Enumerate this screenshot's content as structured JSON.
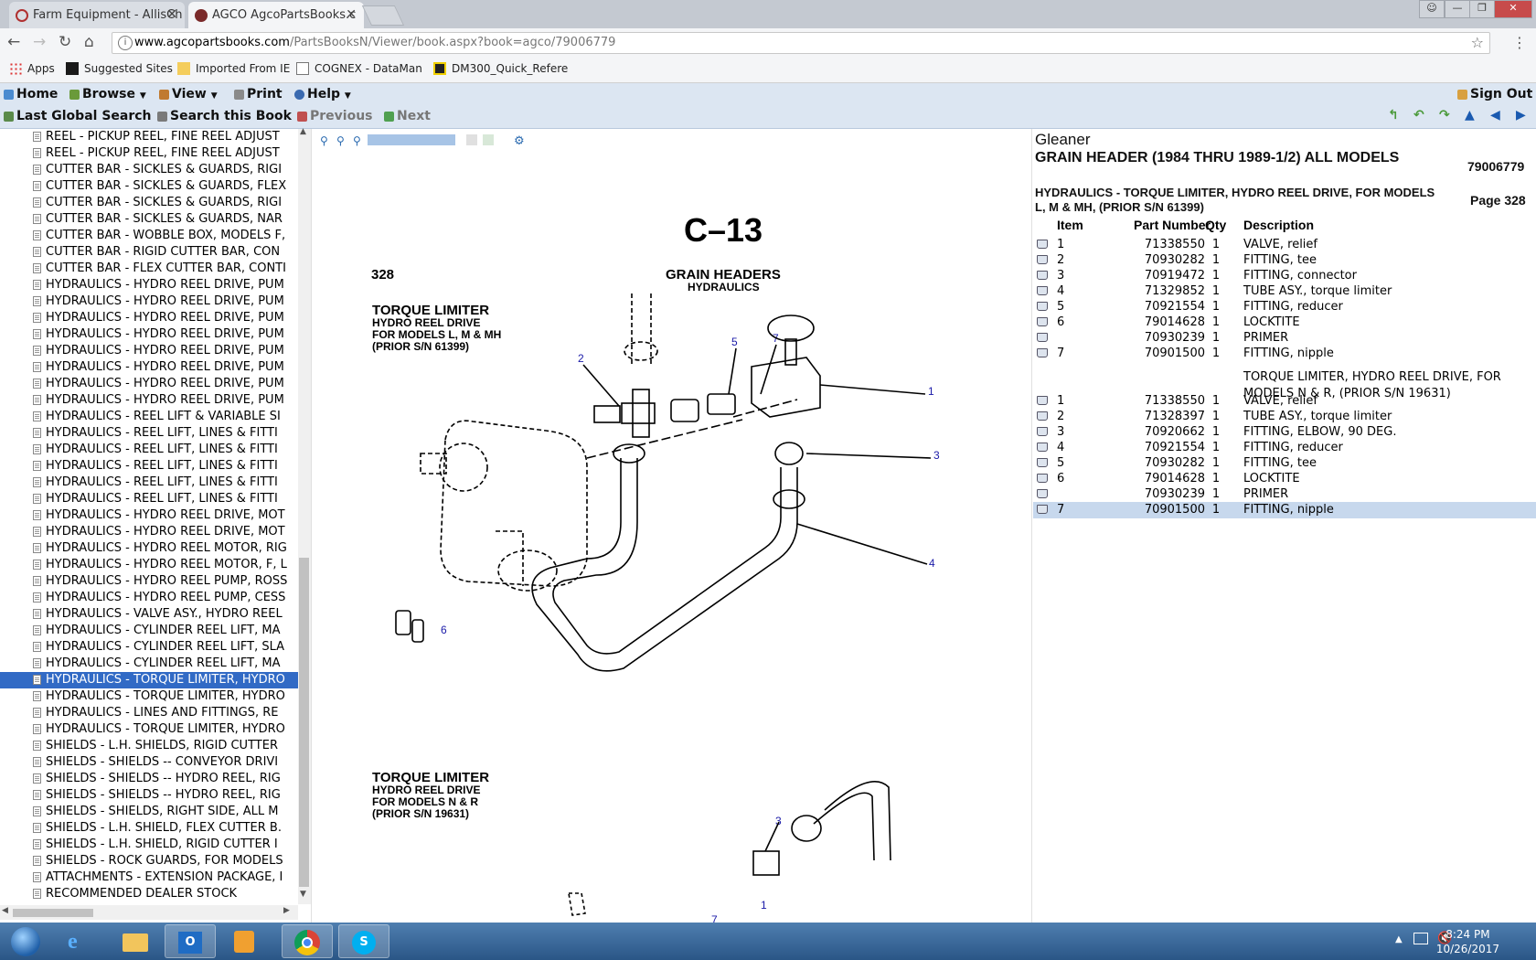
{
  "browser": {
    "tabs": [
      {
        "title": "Farm Equipment - AllisCh",
        "active": false
      },
      {
        "title": "AGCO AgcoPartsBooks.c",
        "active": true
      }
    ],
    "url_host": "www.agcopartsbooks.com",
    "url_path": "/PartsBooksN/Viewer/book.aspx?book=agco/79006779",
    "bookmarks": [
      "Apps",
      "Suggested Sites",
      "Imported From IE",
      "COGNEX - DataMan",
      "DM300_Quick_Refere"
    ]
  },
  "menu": {
    "home": "Home",
    "browse": "Browse",
    "view": "View",
    "print": "Print",
    "help": "Help",
    "signout": "Sign Out",
    "last_search": "Last Global Search",
    "search_book": "Search this Book",
    "previous": "Previous",
    "next": "Next"
  },
  "tree": {
    "items": [
      "REEL - PICKUP REEL, FINE REEL ADJUST",
      "REEL - PICKUP REEL, FINE REEL ADJUST",
      "CUTTER BAR - SICKLES & GUARDS, RIGI",
      "CUTTER BAR - SICKLES & GUARDS, FLEX",
      "CUTTER BAR - SICKLES & GUARDS, RIGI",
      "CUTTER BAR - SICKLES & GUARDS, NAR",
      "CUTTER BAR - WOBBLE BOX, MODELS F,",
      "CUTTER BAR - RIGID CUTTER BAR, CON",
      "CUTTER BAR - FLEX CUTTER BAR, CONTI",
      "HYDRAULICS - HYDRO REEL DRIVE, PUM",
      "HYDRAULICS - HYDRO REEL DRIVE, PUM",
      "HYDRAULICS - HYDRO REEL DRIVE, PUM",
      "HYDRAULICS - HYDRO REEL DRIVE, PUM",
      "HYDRAULICS - HYDRO REEL DRIVE, PUM",
      "HYDRAULICS - HYDRO REEL DRIVE, PUM",
      "HYDRAULICS - HYDRO REEL DRIVE, PUM",
      "HYDRAULICS - HYDRO REEL DRIVE, PUM",
      "HYDRAULICS - REEL LIFT & VARIABLE SI",
      "HYDRAULICS - REEL LIFT, LINES & FITTI",
      "HYDRAULICS - REEL LIFT, LINES & FITTI",
      "HYDRAULICS - REEL LIFT, LINES & FITTI",
      "HYDRAULICS - REEL LIFT, LINES & FITTI",
      "HYDRAULICS - REEL LIFT, LINES & FITTI",
      "HYDRAULICS - HYDRO REEL DRIVE, MOT",
      "HYDRAULICS - HYDRO REEL DRIVE, MOT",
      "HYDRAULICS - HYDRO REEL MOTOR, RIG",
      "HYDRAULICS - HYDRO REEL MOTOR, F, L",
      "HYDRAULICS - HYDRO REEL PUMP, ROSS",
      "HYDRAULICS - HYDRO REEL PUMP, CESS",
      "HYDRAULICS - VALVE ASY., HYDRO REEL",
      "HYDRAULICS - CYLINDER REEL LIFT, MA",
      "HYDRAULICS - CYLINDER REEL LIFT, SLA",
      "HYDRAULICS - CYLINDER REEL LIFT, MA",
      "HYDRAULICS - TORQUE LIMITER, HYDRO",
      "HYDRAULICS - TORQUE LIMITER, HYDRO",
      "HYDRAULICS - LINES AND FITTINGS, RE",
      "HYDRAULICS - TORQUE LIMITER, HYDRO",
      "SHIELDS - L.H. SHIELDS, RIGID CUTTER",
      "SHIELDS - SHIELDS -- CONVEYOR DRIVI",
      "SHIELDS - SHIELDS -- HYDRO REEL, RIG",
      "SHIELDS - SHIELDS -- HYDRO REEL, RIG",
      "SHIELDS - SHIELDS, RIGHT SIDE, ALL M",
      "SHIELDS - L.H. SHIELD, FLEX CUTTER B.",
      "SHIELDS - L.H. SHIELD, RIGID CUTTER I",
      "SHIELDS - ROCK GUARDS, FOR MODELS",
      "ATTACHMENTS - EXTENSION PACKAGE, I",
      "RECOMMENDED DEALER STOCK"
    ],
    "selected_index": 33
  },
  "drawing": {
    "sheet_code": "C–13",
    "page_no": "328",
    "header1": "GRAIN HEADERS",
    "header2": "HYDRAULICS",
    "title_a": [
      "TORQUE LIMITER",
      "HYDRO REEL DRIVE",
      "FOR MODELS L, M & MH",
      "(PRIOR S/N 61399)"
    ],
    "title_b": [
      "TORQUE LIMITER",
      "HYDRO REEL DRIVE",
      "FOR MODELS N & R",
      "(PRIOR S/N 19631)"
    ],
    "callouts_a": [
      "1",
      "2",
      "3",
      "4",
      "5",
      "6",
      "7"
    ],
    "callouts_b": [
      "3",
      "1",
      "7"
    ]
  },
  "parts": {
    "brand": "Gleaner",
    "book_title": "GRAIN HEADER (1984 THRU 1989-1/2) ALL MODELS",
    "book_number": "79006779",
    "section_title": "HYDRAULICS - TORQUE LIMITER, HYDRO REEL DRIVE, FOR MODELS L, M & MH, (PRIOR S/N 61399)",
    "page_label": "Page 328",
    "columns": {
      "item": "Item",
      "part": "Part Number",
      "qty": "Qty",
      "desc": "Description"
    },
    "rows_a": [
      {
        "item": "1",
        "part": "71338550",
        "qty": "1",
        "desc": "VALVE, relief"
      },
      {
        "item": "2",
        "part": "70930282",
        "qty": "1",
        "desc": "FITTING, tee"
      },
      {
        "item": "3",
        "part": "70919472",
        "qty": "1",
        "desc": "FITTING, connector"
      },
      {
        "item": "4",
        "part": "71329852",
        "qty": "1",
        "desc": "TUBE ASY., torque limiter"
      },
      {
        "item": "5",
        "part": "70921554",
        "qty": "1",
        "desc": "FITTING, reducer"
      },
      {
        "item": "6",
        "part": "79014628",
        "qty": "1",
        "desc": "LOCKTITE"
      },
      {
        "item": "",
        "part": "70930239",
        "qty": "1",
        "desc": "PRIMER"
      },
      {
        "item": "7",
        "part": "70901500",
        "qty": "1",
        "desc": "FITTING, nipple"
      }
    ],
    "subsection": "TORQUE LIMITER, HYDRO REEL DRIVE, FOR MODELS N & R, (PRIOR S/N 19631)",
    "rows_b": [
      {
        "item": "1",
        "part": "71338550",
        "qty": "1",
        "desc": "VALVE, relief"
      },
      {
        "item": "2",
        "part": "71328397",
        "qty": "1",
        "desc": "TUBE ASY., torque limiter"
      },
      {
        "item": "3",
        "part": "70920662",
        "qty": "1",
        "desc": "FITTING, ELBOW, 90 DEG."
      },
      {
        "item": "4",
        "part": "70921554",
        "qty": "1",
        "desc": "FITTING, reducer"
      },
      {
        "item": "5",
        "part": "70930282",
        "qty": "1",
        "desc": "FITTING, tee"
      },
      {
        "item": "6",
        "part": "79014628",
        "qty": "1",
        "desc": "LOCKTITE"
      },
      {
        "item": "",
        "part": "70930239",
        "qty": "1",
        "desc": "PRIMER"
      },
      {
        "item": "7",
        "part": "70901500",
        "qty": "1",
        "desc": "FITTING, nipple"
      }
    ]
  },
  "taskbar": {
    "apps": [
      "start-orb",
      "internet-explorer",
      "file-explorer",
      "outlook",
      "media-player",
      "chrome",
      "skype"
    ],
    "time": "8:24 PM",
    "date": "10/26/2017"
  },
  "colors": {
    "menu_bg": "#dce6f2",
    "selection": "#316ac5",
    "row_highlight": "#c7d8ed",
    "callout": "#1a1aa8"
  }
}
